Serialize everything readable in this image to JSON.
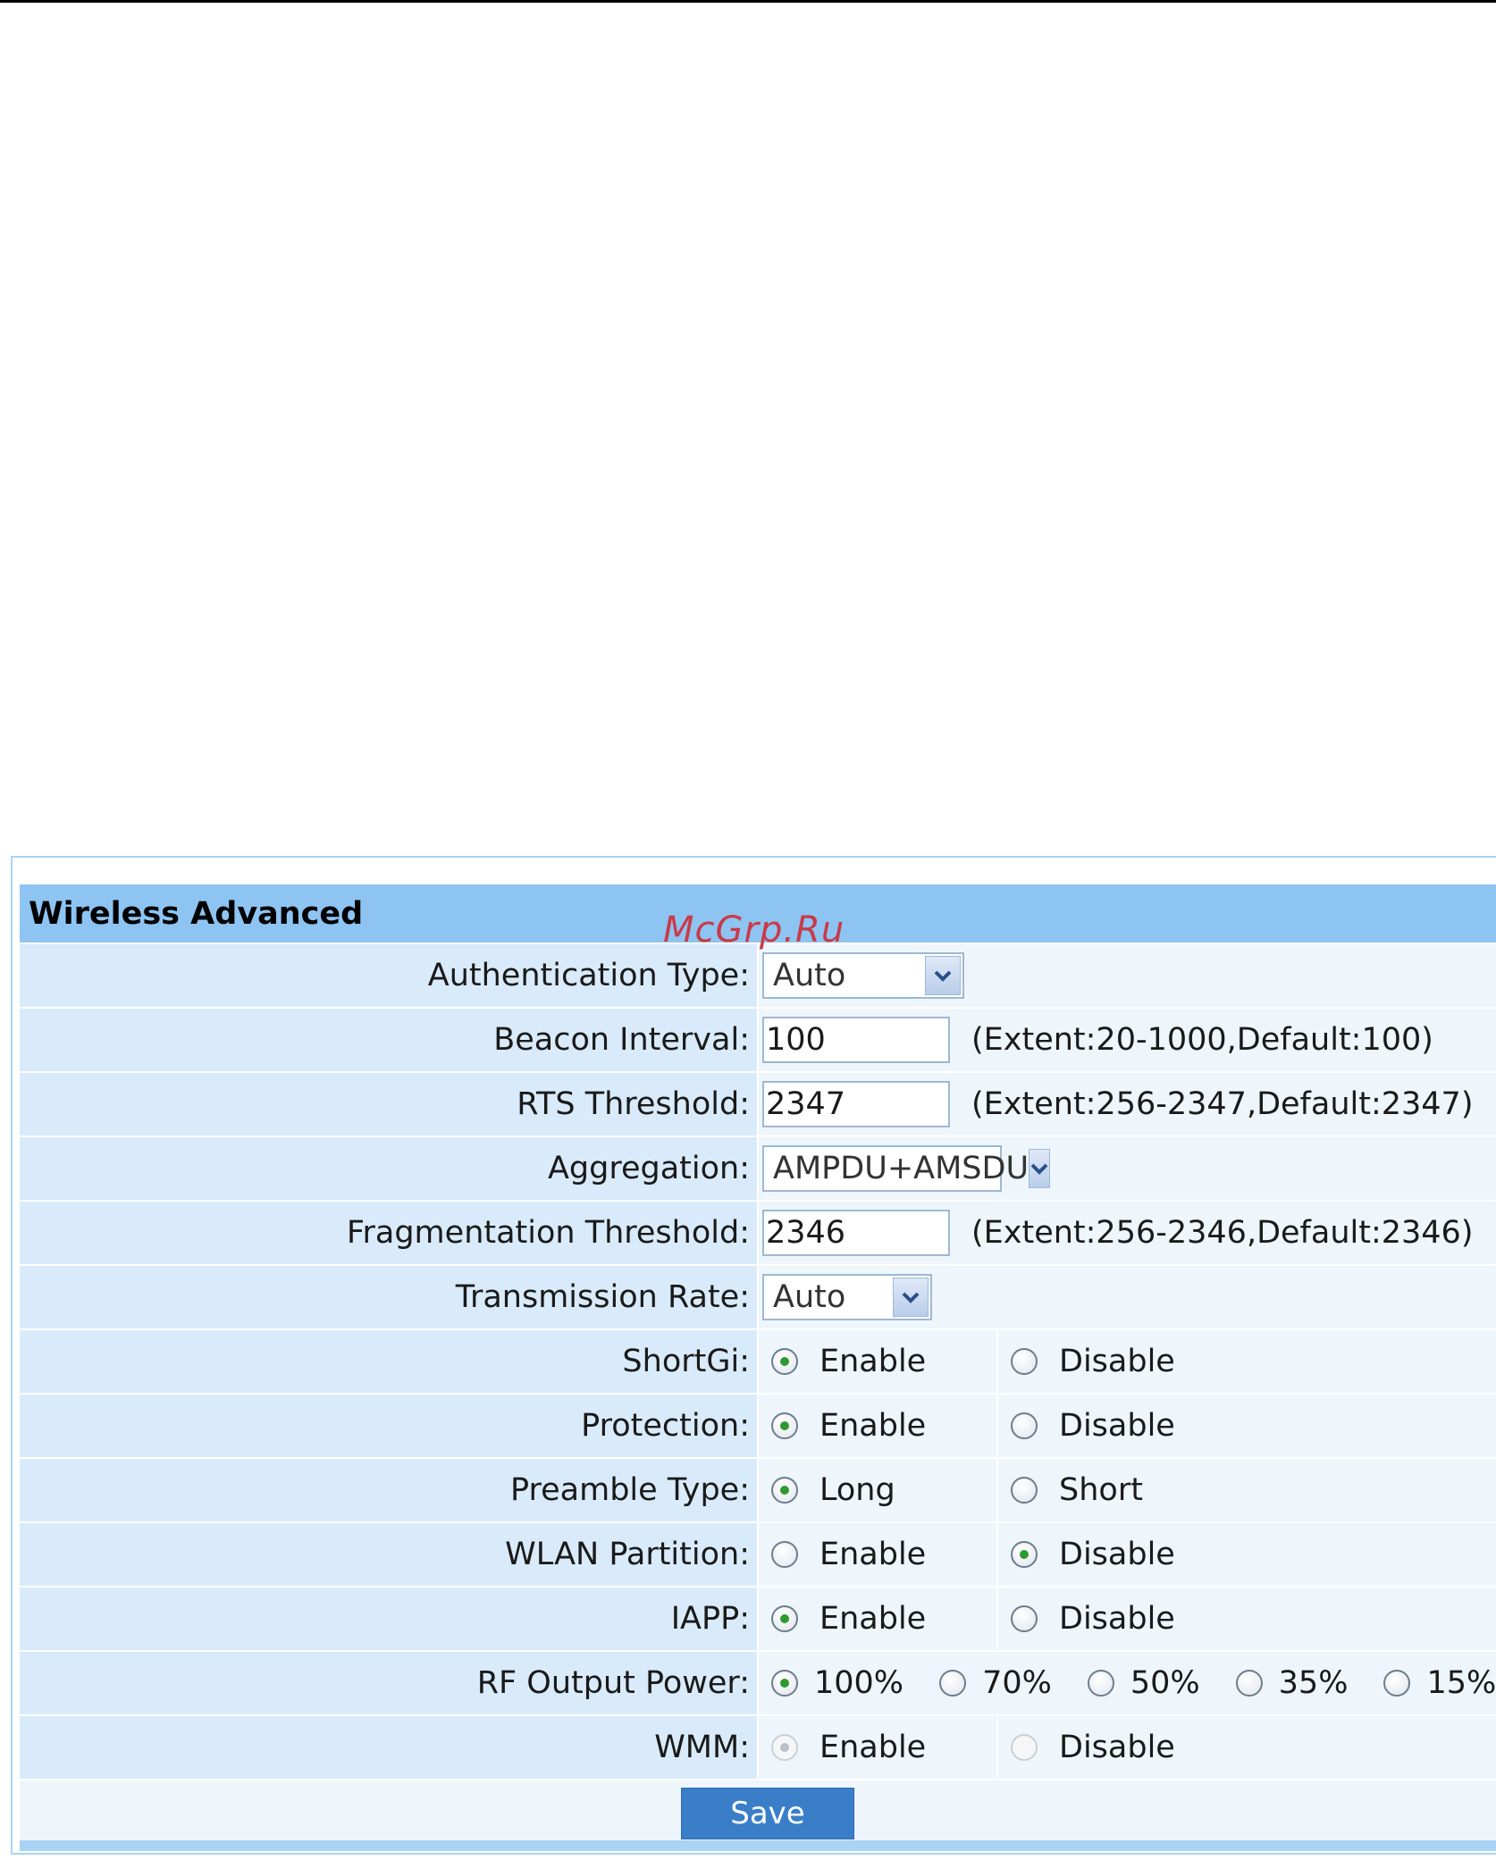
{
  "watermark": "McGrp.Ru",
  "section": {
    "title": "Wireless Advanced"
  },
  "fields": {
    "auth_type": {
      "label": "Authentication Type:",
      "value": "Auto"
    },
    "beacon_interval": {
      "label": "Beacon Interval:",
      "value": "100",
      "hint": "(Extent:20-1000,Default:100)"
    },
    "rts_threshold": {
      "label": "RTS Threshold:",
      "value": "2347",
      "hint": "(Extent:256-2347,Default:2347)"
    },
    "aggregation": {
      "label": "Aggregation:",
      "value": "AMPDU+AMSDU"
    },
    "frag_threshold": {
      "label": "Fragmentation Threshold:",
      "value": "2346",
      "hint": "(Extent:256-2346,Default:2346)"
    },
    "tx_rate": {
      "label": "Transmission Rate:",
      "value": "Auto"
    },
    "short_gi": {
      "label": "ShortGi:",
      "option_a": "Enable",
      "option_b": "Disable",
      "selected": "Enable"
    },
    "protection": {
      "label": "Protection:",
      "option_a": "Enable",
      "option_b": "Disable",
      "selected": "Enable"
    },
    "preamble": {
      "label": "Preamble Type:",
      "option_a": "Long",
      "option_b": "Short",
      "selected": "Long"
    },
    "wlan_partition": {
      "label": "WLAN Partition:",
      "option_a": "Enable",
      "option_b": "Disable",
      "selected": "Disable"
    },
    "iapp": {
      "label": "IAPP:",
      "option_a": "Enable",
      "option_b": "Disable",
      "selected": "Enable"
    },
    "rf_power": {
      "label": "RF Output Power:",
      "options": [
        "100%",
        "70%",
        "50%",
        "35%",
        "15%"
      ],
      "selected": "100%"
    },
    "wmm": {
      "label": "WMM:",
      "option_a": "Enable",
      "option_b": "Disable",
      "selected": "Enable",
      "disabled": true
    }
  },
  "actions": {
    "save_label": "Save"
  },
  "colors": {
    "header_bg": "#8ec4f2",
    "label_bg": "#d9ebfa",
    "value_bg": "#eef6fc",
    "save_button": "#3a7ec8",
    "watermark": "#c93a48"
  }
}
